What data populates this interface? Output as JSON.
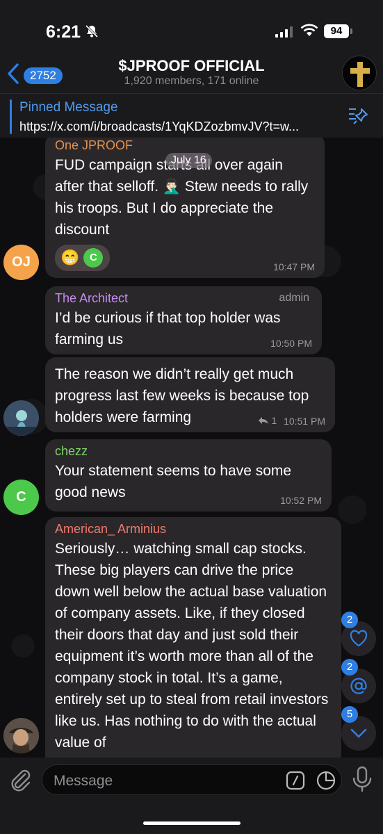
{
  "status_bar": {
    "time": "6:21",
    "battery": "94"
  },
  "header": {
    "back_count": "2752",
    "title": "$JPROOF OFFICIAL",
    "subtitle": "1,920 members, 171 online"
  },
  "pinned": {
    "title": "Pinned Message",
    "text": "https://x.com/i/broadcasts/1YqKDZozbmvJV?t=w..."
  },
  "date_chip": "July 16",
  "messages": [
    {
      "sender": "One JPROOF",
      "text": "FUD campaign starts all over again after that selloff. 🤦🏻‍♂️ Stew needs to rally his troops. But I do appreciate the discount",
      "time": "10:47 PM",
      "avatar_initials": "OJ",
      "reaction_emoji": "😁",
      "reaction_user": "C"
    },
    {
      "sender": "The Architect",
      "role": "admin",
      "text": "I’d be curious if that top holder was farming us",
      "time": "10:50 PM"
    },
    {
      "text": "The reason we didn’t really get much progress last few weeks is because top holders were farming",
      "replies": "1",
      "time": "10:51 PM"
    },
    {
      "sender": "chezz",
      "text": "Your statement seems to have some good news",
      "time": "10:52 PM",
      "avatar_initials": "C"
    },
    {
      "sender": "American_ Arminius",
      "text": "Seriously… watching small cap stocks. These big players can drive the price down well below the actual base valuation of company assets. Like, if they closed their doors that day and just sold their equipment it’s worth more than all of the company stock in total. It’s a game, entirely set up to steal from retail investors like us. Has nothing to do with the actual value of"
    }
  ],
  "floating": {
    "reactions_badge": "2",
    "mentions_badge": "2",
    "unread_badge": "5"
  },
  "composer": {
    "placeholder": "Message"
  },
  "colors": {
    "accent": "#2f7fe3",
    "sender_one_jproof": "#e5914d",
    "sender_architect": "#c58cf2",
    "sender_chezz": "#7ed36b",
    "sender_arminius": "#f07a6e",
    "avatar_oj": "#f5a34a",
    "avatar_c": "#4cc94a"
  }
}
